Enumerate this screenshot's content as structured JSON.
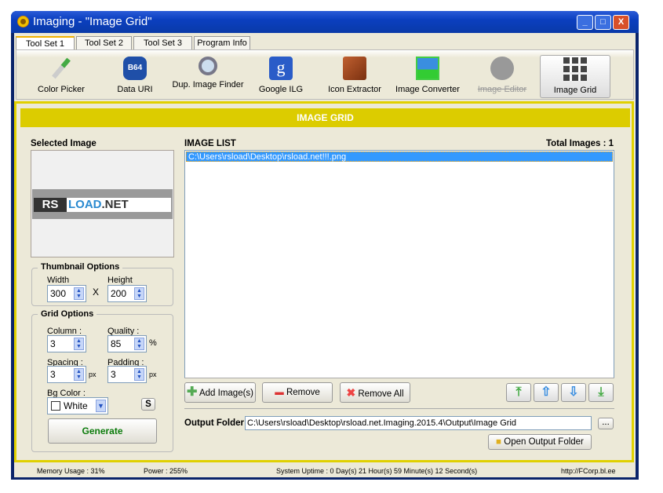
{
  "window": {
    "title": "Imaging - \"Image Grid\"",
    "minimize": "_",
    "maximize": "□",
    "close": "X"
  },
  "tabs": [
    {
      "label": "Tool Set 1"
    },
    {
      "label": "Tool Set 2"
    },
    {
      "label": "Tool Set 3"
    },
    {
      "label": "Program Info"
    }
  ],
  "tools": [
    {
      "label": "Color Picker",
      "icon": "eyedropper-icon"
    },
    {
      "label": "Data URI",
      "icon": "b64-icon",
      "glyph": "B64"
    },
    {
      "label": "Dup. Image Finder",
      "icon": "magnifier-icon"
    },
    {
      "label": "Google ILG",
      "icon": "google-icon",
      "glyph": "g"
    },
    {
      "label": "Icon Extractor",
      "icon": "box-icon"
    },
    {
      "label": "Image Converter",
      "icon": "convert-icon"
    },
    {
      "label": "Image Editor",
      "icon": "palette-icon"
    },
    {
      "label": "Image Grid",
      "icon": "grid-icon"
    }
  ],
  "panel": {
    "header": "IMAGE GRID",
    "selected_image_label": "Selected Image",
    "logo_text": "RSLOAD.NET",
    "image_list_label": "IMAGE LIST",
    "total_images": "Total Images : 1",
    "items": [
      "C:\\Users\\rsload\\Desktop\\rsload.net!!!.png"
    ]
  },
  "thumbnail": {
    "title": "Thumbnail Options",
    "width_label": "Width",
    "width": "300",
    "x": "X",
    "height_label": "Height",
    "height": "200"
  },
  "grid": {
    "title": "Grid Options",
    "column_label": "Column :",
    "column": "3",
    "quality_label": "Quality :",
    "quality": "85",
    "percent": "%",
    "spacing_label": "Spacing :",
    "spacing": "3",
    "px1": "px",
    "padding_label": "Padding :",
    "padding": "3",
    "px2": "px",
    "bg_label": "Bg Color :",
    "bg": "White",
    "s": "S",
    "generate": "Generate"
  },
  "actions": {
    "add": "Add Image(s)",
    "remove": "Remove",
    "remove_all": "Remove All"
  },
  "output": {
    "label": "Output Folder",
    "path": "C:\\Users\\rsload\\Desktop\\rsload.net.Imaging.2015.4\\Output\\Image Grid",
    "browse": "...",
    "open": "Open Output Folder"
  },
  "status": {
    "memory": "Memory Usage : 31%",
    "power": "Power : 255%",
    "uptime": "System Uptime : 0 Day(s) 21 Hour(s) 59 Minute(s) 12 Second(s)",
    "url": "http://FCorp.bl.ee"
  },
  "colors": {
    "accent": "#dccc00",
    "selection": "#3399ff",
    "title": "#0b3fbf"
  }
}
